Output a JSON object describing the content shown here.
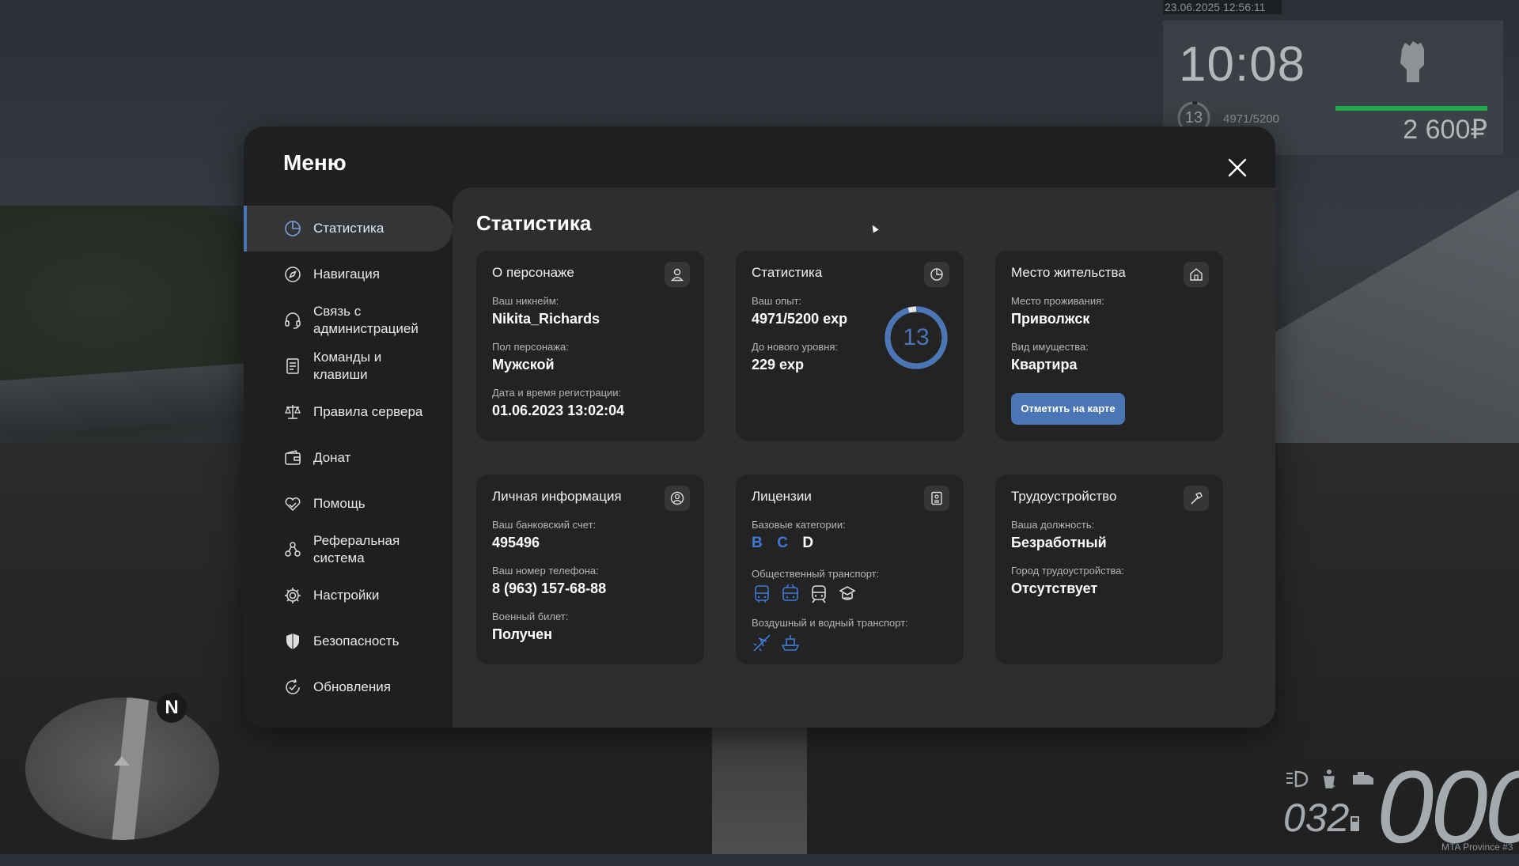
{
  "hud": {
    "datetime": "23.06.2025 12:56:11",
    "clock": "10:08",
    "level": "13",
    "exp": "4971/5200",
    "money": "2 600₽",
    "gear": "032",
    "speed": "000",
    "watermark": "MTA Province #3",
    "minimap_north": "N",
    "level_fraction": 0.956,
    "colors": {
      "exp_bar": "#1ea84a"
    }
  },
  "menu": {
    "title": "Меню",
    "close_icon": "close-icon",
    "sidebar": [
      {
        "label": "Статистика",
        "icon": "pie-chart-icon",
        "active": true
      },
      {
        "label": "Навигация",
        "icon": "compass-icon",
        "active": false
      },
      {
        "label": "Связь с администрацией",
        "icon": "headset-icon",
        "active": false
      },
      {
        "label": "Команды и клавиши",
        "icon": "document-icon",
        "active": false
      },
      {
        "label": "Правила сервера",
        "icon": "scales-icon",
        "active": false
      },
      {
        "label": "Донат",
        "icon": "wallet-icon",
        "active": false
      },
      {
        "label": "Помощь",
        "icon": "heart-hands-icon",
        "active": false
      },
      {
        "label": "Реферальная система",
        "icon": "people-network-icon",
        "active": false
      },
      {
        "label": "Настройки",
        "icon": "gear-icon",
        "active": false
      },
      {
        "label": "Безопасность",
        "icon": "shield-icon",
        "active": false
      },
      {
        "label": "Обновления",
        "icon": "refresh-check-icon",
        "active": false
      }
    ],
    "colors": {
      "accent": "#4a76b8",
      "modal_bg": "#1f1f20",
      "content_bg": "#2e2e2f",
      "card_bg": "#232323"
    }
  },
  "content": {
    "title": "Статистика",
    "character": {
      "title": "О персонаже",
      "icon": "user-icon",
      "nickname_label": "Ваш никнейм:",
      "nickname": "Nikita_Richards",
      "gender_label": "Пол персонажа:",
      "gender": "Мужской",
      "reg_label": "Дата и время регистрации:",
      "reg": "01.06.2023 13:02:04"
    },
    "stats": {
      "title": "Статистика",
      "icon": "pie-chart-icon",
      "exp_label": "Ваш опыт:",
      "exp": "4971/5200 exp",
      "next_label": "До нового уровня:",
      "next": "229 exp",
      "level": "13",
      "exp_current": 4971,
      "exp_total": 5200
    },
    "residence": {
      "title": "Место жительства",
      "icon": "house-icon",
      "place_label": "Место проживания:",
      "place": "Приволжск",
      "property_label": "Вид имущества:",
      "property": "Квартира",
      "map_button": "Отметить на карте"
    },
    "personal": {
      "title": "Личная информация",
      "icon": "user-circle-icon",
      "bank_label": "Ваш банковский счет:",
      "bank": "495496",
      "phone_label": "Ваш номер телефона:",
      "phone": "8 (963) 157-68-88",
      "military_label": "Военный билет:",
      "military": "Получен"
    },
    "licenses": {
      "title": "Лицензии",
      "icon": "id-card-icon",
      "base_label": "Базовые категории:",
      "categories": [
        {
          "name": "B",
          "obtained": true
        },
        {
          "name": "C",
          "obtained": true
        },
        {
          "name": "D",
          "obtained": false
        }
      ],
      "public_label": "Общественный транспорт:",
      "public_icons": [
        "bus-icon",
        "trolleybus-icon",
        "train-icon",
        "taxi-icon"
      ],
      "air_label": "Воздушный и водный транспорт:",
      "air_icons": [
        "airplane-icon",
        "boat-icon"
      ]
    },
    "employment": {
      "title": "Трудоустройство",
      "icon": "hammer-icon",
      "job_label": "Ваша должность:",
      "job": "Безработный",
      "city_label": "Город трудоустройства:",
      "city": "Отсутствует"
    }
  }
}
